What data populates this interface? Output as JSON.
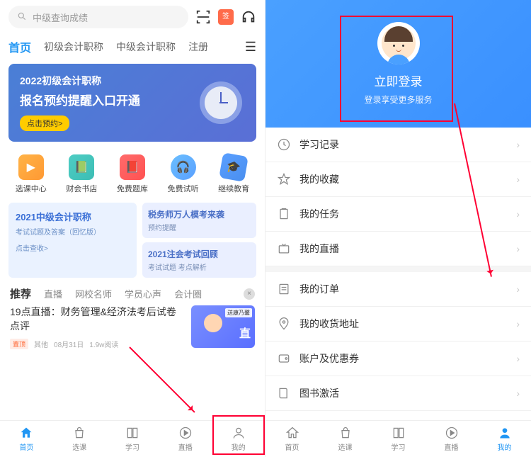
{
  "search": {
    "placeholder": "中级查询成绩"
  },
  "calendar_icon_text": "签",
  "top_tabs": [
    "首页",
    "初级会计职称",
    "中级会计职称",
    "注册"
  ],
  "banner": {
    "title": "2022初级会计职称",
    "subtitle": "报名预约提醒入口开通",
    "button": "点击预约>"
  },
  "funcs": [
    {
      "label": "选课中心"
    },
    {
      "label": "财会书店"
    },
    {
      "label": "免费题库"
    },
    {
      "label": "免费试听"
    },
    {
      "label": "继续教育"
    }
  ],
  "card_left": {
    "title": "2021中级会计职称",
    "sub": "考试试题及答案（回忆版）",
    "link": "点击查收>"
  },
  "card_right_1": {
    "title": "税务师万人模考来袭",
    "sub": "预约提醒"
  },
  "card_right_2": {
    "title": "2021注会考试回顾",
    "sub": "考试试题 考点解析"
  },
  "rec_tabs": [
    "推荐",
    "直播",
    "网校名师",
    "学员心声",
    "会计圈"
  ],
  "article": {
    "title": "19点直播：财务管理&经济法考后试卷点评",
    "badge": "置顶",
    "meta_source": "其他",
    "meta_date": "08月31日",
    "meta_reads": "1.9w阅读",
    "img_sticker": "送康乃馨",
    "img_text": "直"
  },
  "bottom_nav_left": [
    {
      "label": "首页"
    },
    {
      "label": "选课"
    },
    {
      "label": "学习"
    },
    {
      "label": "直播"
    },
    {
      "label": "我的"
    }
  ],
  "bottom_nav_right": [
    {
      "label": "首页"
    },
    {
      "label": "选课"
    },
    {
      "label": "学习"
    },
    {
      "label": "直播"
    },
    {
      "label": "我的"
    }
  ],
  "login": {
    "title": "立即登录",
    "sub": "登录享受更多服务"
  },
  "menu_group_1": [
    {
      "label": "学习记录"
    },
    {
      "label": "我的收藏"
    },
    {
      "label": "我的任务"
    },
    {
      "label": "我的直播"
    }
  ],
  "menu_group_2": [
    {
      "label": "我的订单"
    },
    {
      "label": "我的收货地址"
    },
    {
      "label": "账户及优惠券"
    },
    {
      "label": "图书激活"
    }
  ]
}
